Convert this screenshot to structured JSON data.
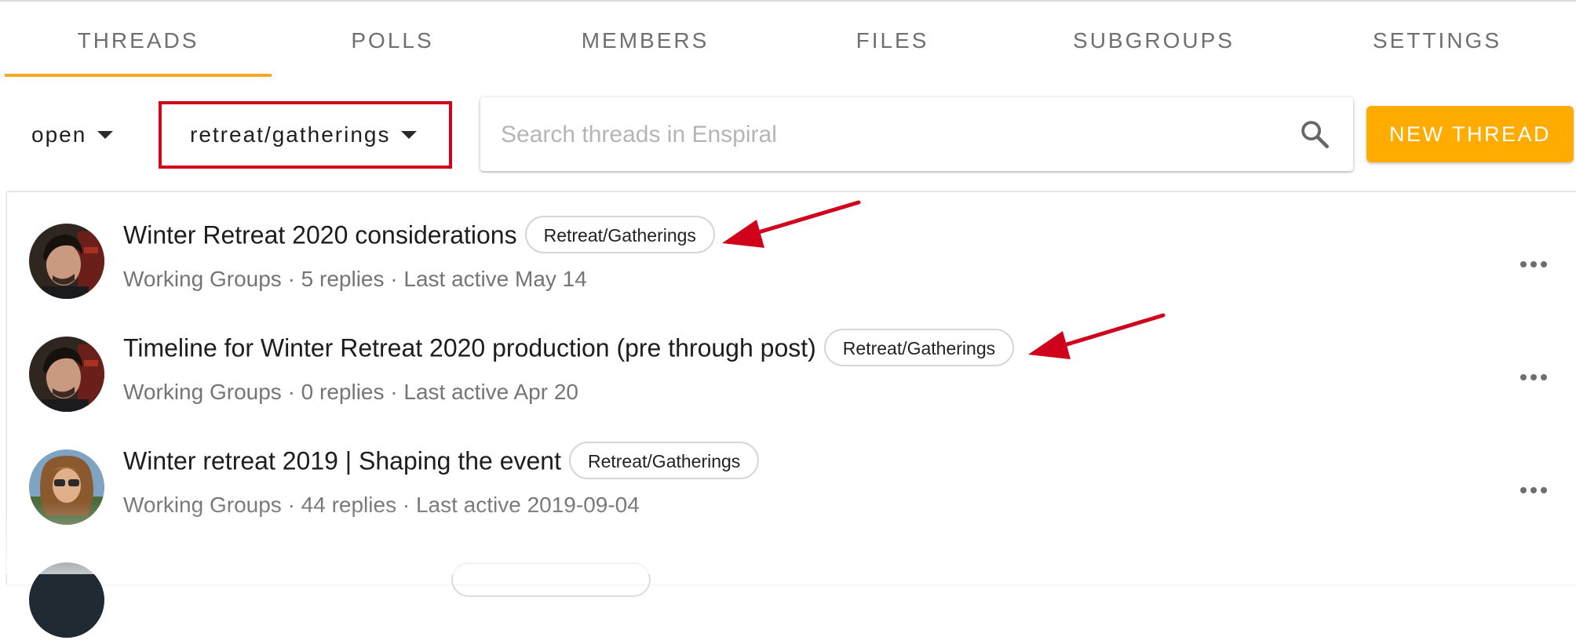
{
  "tabs": [
    {
      "label": "THREADS",
      "active": true
    },
    {
      "label": "POLLS",
      "active": false
    },
    {
      "label": "MEMBERS",
      "active": false
    },
    {
      "label": "FILES",
      "active": false
    },
    {
      "label": "SUBGROUPS",
      "active": false
    },
    {
      "label": "SETTINGS",
      "active": false
    }
  ],
  "toolbar": {
    "status_filter": "open",
    "tag_filter": "retreat/gatherings",
    "search_placeholder": "Search threads in Enspiral",
    "new_thread_label": "NEW THREAD"
  },
  "threads": [
    {
      "title": "Winter Retreat 2020 considerations",
      "tag": "Retreat/Gatherings",
      "meta": "Working Groups · 5 replies  · Last active May 14",
      "avatar": "avatar-man-dark-hair"
    },
    {
      "title": "Timeline for Winter Retreat 2020 production (pre through post)",
      "tag": "Retreat/Gatherings",
      "meta": "Working Groups · 0 replies  · Last active Apr 20",
      "avatar": "avatar-man-dark-hair"
    },
    {
      "title": "Winter retreat 2019 | Shaping the event",
      "tag": "Retreat/Gatherings",
      "meta": "Working Groups · 44 replies  · Last active 2019-09-04",
      "avatar": "avatar-person-curly-hair"
    }
  ],
  "colors": {
    "accent": "#ffab00",
    "tab_indicator": "#f5a623",
    "annotation_red": "#d0021b"
  },
  "icons": [
    "search-icon",
    "caret-down-icon",
    "more-horiz-icon",
    "annotation-arrow"
  ]
}
